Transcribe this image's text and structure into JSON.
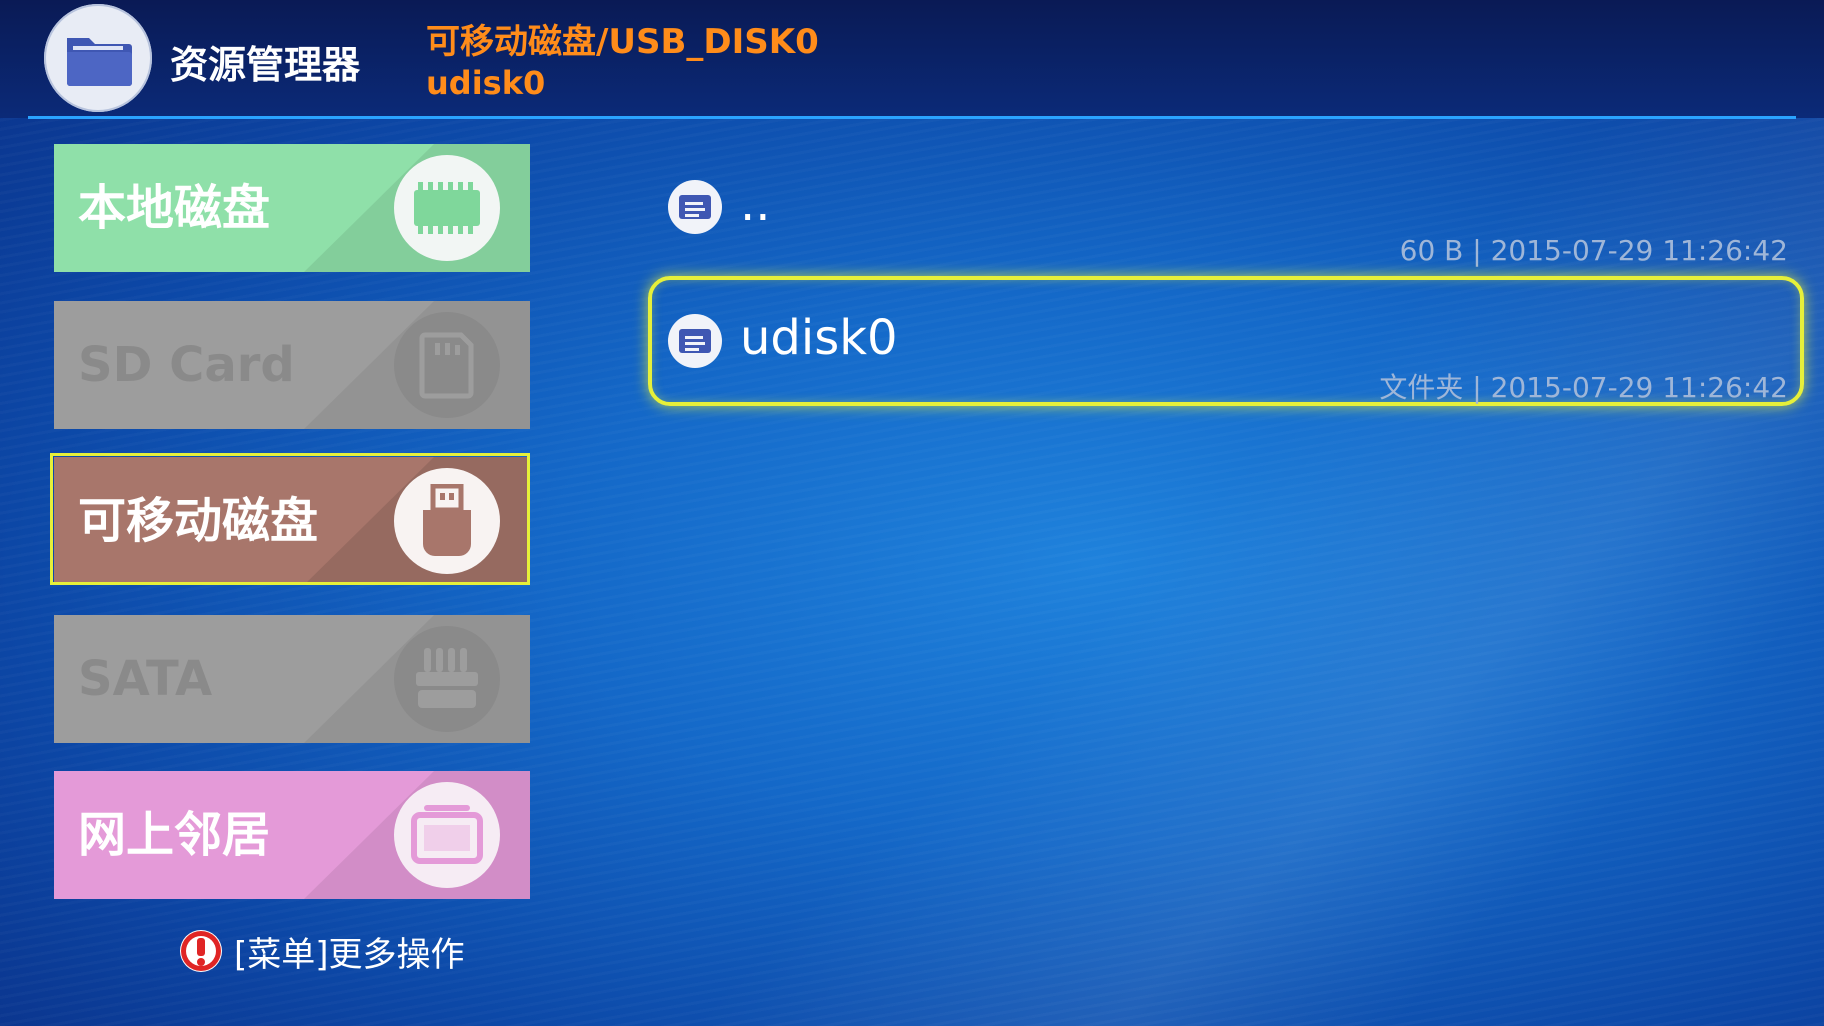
{
  "app": {
    "title": "资源管理器",
    "breadcrumb": "可移动磁盘/USB_DISK0",
    "current_folder": "udisk0"
  },
  "sidebar": {
    "items": [
      {
        "label": "本地磁盘",
        "icon": "memory-chip-icon",
        "state": "enabled"
      },
      {
        "label": "SD Card",
        "icon": "sd-card-icon",
        "state": "disabled"
      },
      {
        "label": "可移动磁盘",
        "icon": "usb-drive-icon",
        "state": "selected"
      },
      {
        "label": "SATA",
        "icon": "sata-drive-icon",
        "state": "disabled"
      },
      {
        "label": "网上邻居",
        "icon": "network-computer-icon",
        "state": "enabled"
      }
    ]
  },
  "hint": {
    "text": "[菜单]更多操作",
    "icon": "alert-icon"
  },
  "files": [
    {
      "name": "..",
      "meta": "60 B | 2015-07-29 11:26:42",
      "icon": "folder-icon"
    },
    {
      "name": "udisk0",
      "meta": "文件夹 | 2015-07-29 11:26:42",
      "icon": "folder-icon",
      "focused": true
    }
  ],
  "colors": {
    "accent_orange": "#ff8c1a",
    "focus_yellow": "#e6f03a",
    "local_disk": "#8fe0a9",
    "removable_disk": "#a8766b",
    "network": "#e49ad8",
    "disabled": "#9d9d9d"
  }
}
